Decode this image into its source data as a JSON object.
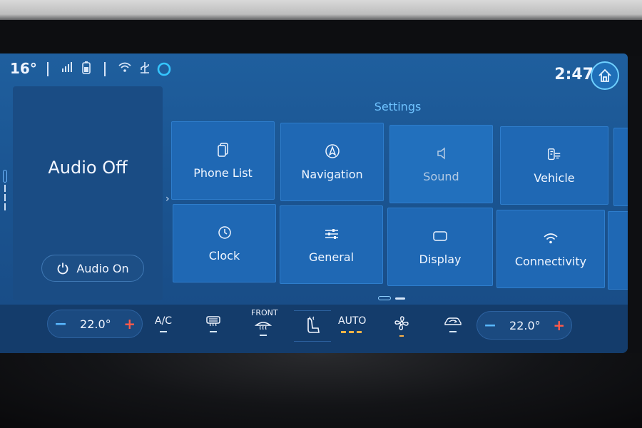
{
  "status": {
    "outside_temp": "16°",
    "time": "2:47",
    "icons": [
      "signal-icon",
      "phone-battery-icon",
      "wifi-icon",
      "usb-icon",
      "assistant-icon"
    ]
  },
  "audio": {
    "state": "Audio Off",
    "on_button": "Audio On"
  },
  "settings": {
    "title": "Settings",
    "tiles": [
      {
        "label": "Phone List",
        "icon": "phone-list-icon"
      },
      {
        "label": "Navigation",
        "icon": "navigation-icon"
      },
      {
        "label": "Sound",
        "icon": "speaker-icon"
      },
      {
        "label": "Vehicle",
        "icon": "vehicle-icon"
      },
      {
        "label": "Clock",
        "icon": "clock-icon"
      },
      {
        "label": "General",
        "icon": "sliders-icon"
      },
      {
        "label": "Display",
        "icon": "display-icon"
      },
      {
        "label": "Connectivity",
        "icon": "wifi-icon"
      }
    ]
  },
  "climate": {
    "left_temp": "22.0°",
    "right_temp": "22.0°",
    "ac_label": "A/C",
    "front_label": "FRONT",
    "auto_label": "AUTO"
  },
  "colors": {
    "screen_blue": "#1b5592",
    "tile_blue": "#1f68b4",
    "accent_cyan": "#6fc3ff",
    "plus_red": "#ff5a4a",
    "auto_amber": "#ffb347"
  }
}
